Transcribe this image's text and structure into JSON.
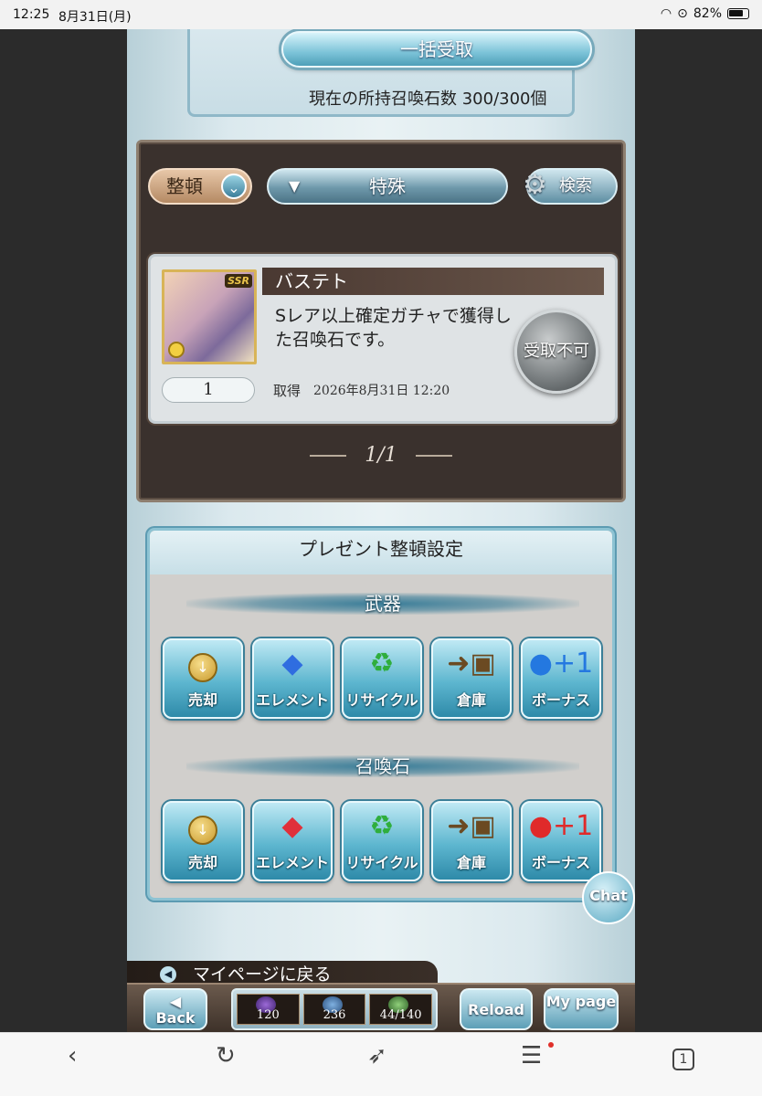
{
  "status_bar": {
    "time": "12:25",
    "date": "8月31日(月)",
    "battery": "82%"
  },
  "receive": {
    "receive_all_label": "一括受取",
    "stone_count": "現在の所持召喚石数 300/300個"
  },
  "list": {
    "sort_label": "整頓",
    "filter_label": "特殊",
    "search_label": "検索",
    "item": {
      "name": "バステト",
      "rarity": "SSR",
      "description": "Sレア以上確定ガチャで獲得した召喚石です。",
      "quantity": "1",
      "acquired_label": "取得",
      "acquired_date": "2026年8月31日 12:20",
      "receive_status_label": "受取不可"
    },
    "pager": "1/1"
  },
  "settings": {
    "title": "プレゼント整頓設定",
    "weapon_section": "武器",
    "summon_section": "召喚石",
    "weapon_buttons": [
      "売却",
      "エレメント",
      "リサイクル",
      "倉庫",
      "ボーナス"
    ],
    "summon_buttons": [
      "売却",
      "エレメント",
      "リサイクル",
      "倉庫",
      "ボーナス"
    ]
  },
  "chat_label": "Chat",
  "back_to_mypage": "マイページに戻る",
  "footer": {
    "back_label": "Back",
    "reload_label": "Reload",
    "mypage_label": "My page",
    "counters": [
      "120",
      "236",
      "44/140"
    ]
  },
  "browser": {
    "tab_count": "1"
  },
  "colors": {
    "accent": "#5db6cf",
    "panel_dark": "#3a312d",
    "notification_dot": "#e0302a"
  }
}
